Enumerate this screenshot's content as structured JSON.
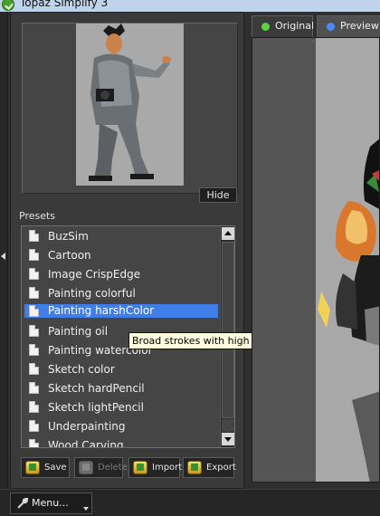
{
  "window": {
    "title": "Topaz Simplify 3"
  },
  "navigator": {
    "hide_label": "Hide"
  },
  "presets": {
    "heading": "Presets",
    "items": [
      {
        "label": "BuzSim"
      },
      {
        "label": "Cartoon"
      },
      {
        "label": "Image CrispEdge"
      },
      {
        "label": "Painting colorful"
      },
      {
        "label": "Painting harshColor",
        "selected": true
      },
      {
        "label": "Painting oil"
      },
      {
        "label": "Painting watercolor"
      },
      {
        "label": "Sketch color"
      },
      {
        "label": "Sketch hardPencil"
      },
      {
        "label": "Sketch lightPencil"
      },
      {
        "label": "Underpainting"
      },
      {
        "label": "Wood Carving"
      }
    ],
    "tooltip": "Broad strokes with high contrast and color"
  },
  "preset_buttons": {
    "save": "Save",
    "delete": "Delete",
    "import": "Import",
    "export": "Export"
  },
  "view_tabs": {
    "original": "Original",
    "preview": "Preview",
    "active": "Preview"
  },
  "bottom": {
    "menu_label": "Menu..."
  },
  "colors": {
    "selection": "#3f7de8",
    "original_dot": "#5bd33c",
    "preview_dot": "#4a8cff",
    "tooltip_bg": "#fdfde0"
  }
}
